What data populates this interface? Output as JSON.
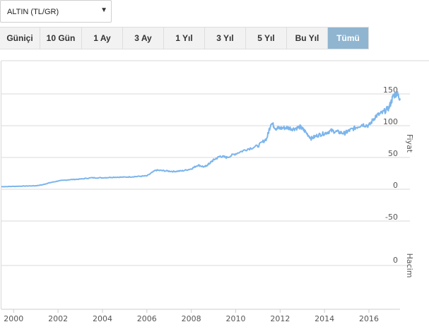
{
  "selector": {
    "value": "ALTIN (TL/GR)"
  },
  "range_tabs": [
    {
      "label": "Güniçi",
      "active": false
    },
    {
      "label": "10 Gün",
      "active": false
    },
    {
      "label": "1 Ay",
      "active": false
    },
    {
      "label": "3 Ay",
      "active": false
    },
    {
      "label": "1 Yıl",
      "active": false
    },
    {
      "label": "3 Yıl",
      "active": false
    },
    {
      "label": "5 Yıl",
      "active": false
    },
    {
      "label": "Bu Yıl",
      "active": false
    },
    {
      "label": "Tümü",
      "active": true
    }
  ],
  "colors": {
    "line": "#7cb5ec",
    "active_tab": "#8fb5d0",
    "grid": "#d8d8d8"
  },
  "chart_data": {
    "type": "line",
    "title": "",
    "price_axis": {
      "label": "Fiyat",
      "ticks": [
        150,
        100,
        50,
        0,
        -50
      ],
      "ylim": [
        -50,
        150
      ]
    },
    "volume_axis": {
      "label": "Hacim",
      "ticks": [
        0
      ]
    },
    "x_ticks": [
      "2000",
      "2002",
      "2004",
      "2006",
      "2008",
      "2010",
      "2012",
      "2014",
      "2016"
    ],
    "xlim": [
      1999.45,
      2017.4
    ],
    "series": [
      {
        "values": [
          [
            1999.45,
            4
          ],
          [
            2000.0,
            4.5
          ],
          [
            2000.5,
            5
          ],
          [
            2001.0,
            5.5
          ],
          [
            2001.3,
            7
          ],
          [
            2001.6,
            10
          ],
          [
            2002.0,
            13
          ],
          [
            2002.5,
            15
          ],
          [
            2003.0,
            16
          ],
          [
            2003.5,
            18
          ],
          [
            2004.0,
            18
          ],
          [
            2004.5,
            19
          ],
          [
            2005.0,
            19
          ],
          [
            2005.5,
            20
          ],
          [
            2006.0,
            21
          ],
          [
            2006.4,
            30
          ],
          [
            2006.8,
            29
          ],
          [
            2007.2,
            28
          ],
          [
            2007.6,
            29
          ],
          [
            2008.0,
            32
          ],
          [
            2008.3,
            38
          ],
          [
            2008.6,
            35
          ],
          [
            2008.8,
            40
          ],
          [
            2009.0,
            46
          ],
          [
            2009.3,
            52
          ],
          [
            2009.6,
            50
          ],
          [
            2010.0,
            56
          ],
          [
            2010.5,
            63
          ],
          [
            2011.0,
            68
          ],
          [
            2011.4,
            80
          ],
          [
            2011.6,
            105
          ],
          [
            2011.8,
            96
          ],
          [
            2012.0,
            96
          ],
          [
            2012.3,
            97
          ],
          [
            2012.6,
            95
          ],
          [
            2012.9,
            98
          ],
          [
            2013.1,
            92
          ],
          [
            2013.4,
            80
          ],
          [
            2013.7,
            85
          ],
          [
            2014.0,
            88
          ],
          [
            2014.3,
            92
          ],
          [
            2014.6,
            90
          ],
          [
            2014.9,
            88
          ],
          [
            2015.1,
            92
          ],
          [
            2015.4,
            97
          ],
          [
            2015.7,
            102
          ],
          [
            2016.0,
            100
          ],
          [
            2016.3,
            115
          ],
          [
            2016.6,
            120
          ],
          [
            2016.9,
            128
          ],
          [
            2017.1,
            147
          ],
          [
            2017.25,
            151
          ],
          [
            2017.4,
            143
          ]
        ]
      }
    ]
  }
}
